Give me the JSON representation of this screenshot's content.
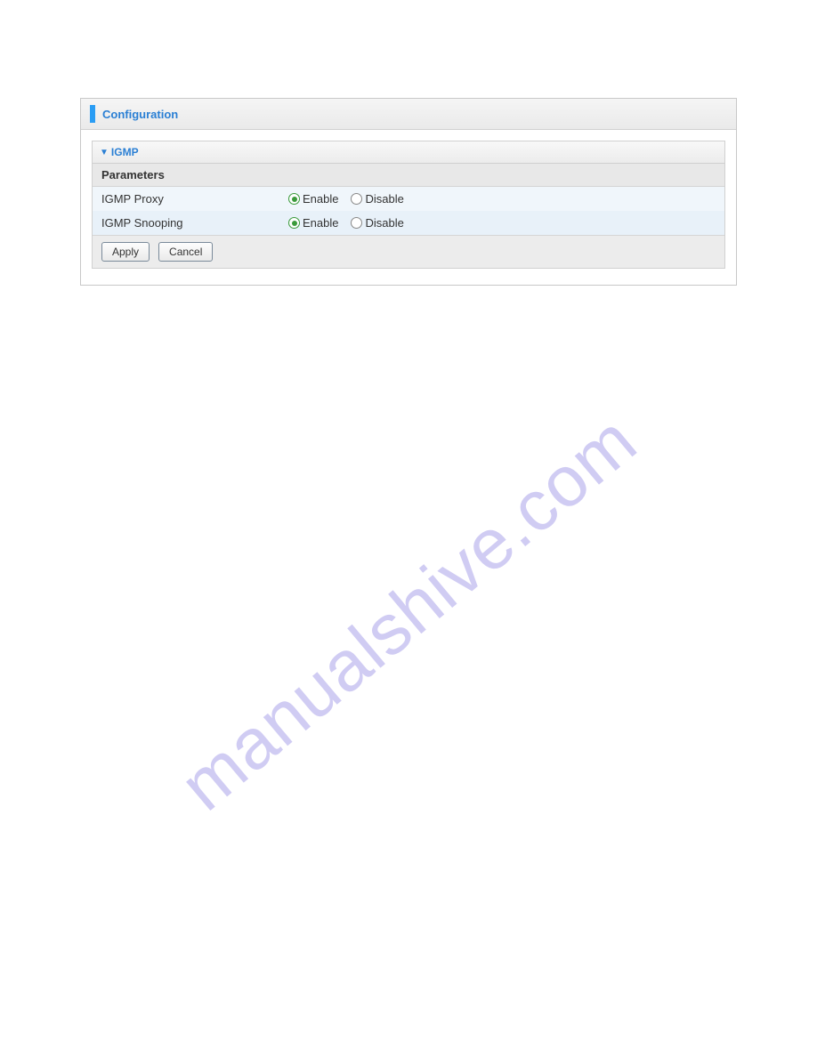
{
  "panel": {
    "title": "Configuration"
  },
  "section": {
    "title": "IGMP",
    "paramsHeader": "Parameters",
    "rows": [
      {
        "label": "IGMP Proxy",
        "options": {
          "enable": "Enable",
          "disable": "Disable"
        },
        "selected": "enable"
      },
      {
        "label": "IGMP Snooping",
        "options": {
          "enable": "Enable",
          "disable": "Disable"
        },
        "selected": "enable"
      }
    ]
  },
  "buttons": {
    "apply": "Apply",
    "cancel": "Cancel"
  },
  "watermark": "manualshive.com"
}
